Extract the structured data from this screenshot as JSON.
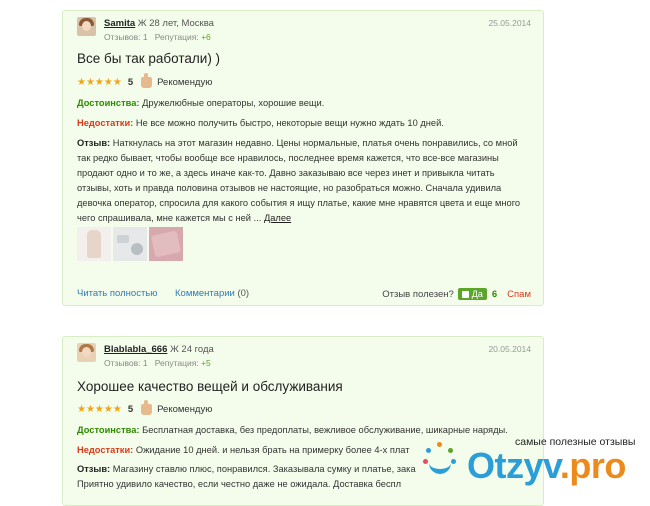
{
  "reviews": [
    {
      "username": "Samita",
      "meta": "Ж 28 лет, Москва",
      "reviews_label": "Отзывов: 1",
      "reputation_label": "Репутация:",
      "reputation_value": "+6",
      "date": "25.05.2014",
      "title": "Все бы так работали) )",
      "stars": "★★★★★",
      "score": "5",
      "recommend": "Рекомендую",
      "pros_label": "Достоинства:",
      "pros": "Дружелюбные операторы, хорошие вещи.",
      "cons_label": "Недостатки:",
      "cons": "Не все можно получить быстро, некоторые вещи нужно ждать 10 дней.",
      "body_label": "Отзыв:",
      "body": "Наткнулась на этот магазин недавно. Цены нормальные, платья очень понравились, со мной так редко бывает, чтобы вообще все нравилось, последнее время кажется, что все-все магазины продают одно и то же, а здесь иначе как-то. Давно заказываю все через инет и привыкла читать отзывы, хоть и правда половина отзывов не настоящие, но разобраться можно. Сначала удивила девочка оператор, спросила для какого события я ищу платье, какие мне нравятся цвета и еще много чего спрашивала, мне кажется мы с ней ...",
      "more": "Далее",
      "read_full": "Читать полностью",
      "comments_label": "Комментарии",
      "comments_count": "(0)",
      "helpful_label": "Отзыв полезен?",
      "yes_label": "Да",
      "yes_count": "6",
      "spam_label": "Спам"
    },
    {
      "username": "Blablabla_666",
      "meta": "Ж 24 года",
      "reviews_label": "Отзывов: 1",
      "reputation_label": "Репутация:",
      "reputation_value": "+5",
      "date": "20.05.2014",
      "title": "Хорошее качество вещей и обслуживания",
      "stars": "★★★★★",
      "score": "5",
      "recommend": "Рекомендую",
      "pros_label": "Достоинства:",
      "pros": "Бесплатная доставка, без предоплаты, вежливое обслуживание, шикарные наряды.",
      "cons_label": "Недостатки:",
      "cons": "Ожидание 10 дней. и нельзя брать на примерку более 4-х плат",
      "body_label": "Отзыв:",
      "body": "Магазину ставлю плюс, понравился. Заказывала сумку и платье, зака",
      "body_line2": "Приятно удивило качество, если честно даже не ожидала. Доставка беспл"
    }
  ],
  "watermark": {
    "tagline": "самые полезные отзывы",
    "brand": "Otzyv",
    "dot": ".",
    "tld": "pro"
  },
  "colors": {
    "card_bg": "#f4fdeb",
    "card_border": "#d8ecc6",
    "pros": "#2f8a00",
    "cons": "#d93a1a",
    "link": "#2f7bb8",
    "stars": "#f2a516",
    "brand": "#2b9ed8",
    "brand_accent": "#ec8a1c"
  }
}
